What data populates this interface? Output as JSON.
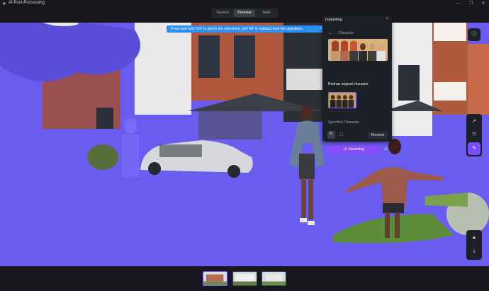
{
  "app": {
    "title": "AI Post-Processing"
  },
  "window_controls": {
    "minimize": "—",
    "maximize": "❐",
    "close": "✕"
  },
  "tabs": [
    {
      "label": "Source",
      "active": false
    },
    {
      "label": "Preview",
      "active": true
    },
    {
      "label": "Task",
      "active": false
    }
  ],
  "toast": {
    "message": "Press and hold 'Ctrl' to add to the selections, and 'Alt' to subtract from the selections.",
    "close": "×"
  },
  "panel": {
    "title": "Inpainting",
    "close": "×",
    "back_label": "Character",
    "redraw_label": "Redraw original character",
    "specified_label": "Specified Character",
    "reverse_label": "Reverse",
    "inpaint_label": "Inpainting",
    "inpaint_icon": "✨"
  },
  "right_toolbar": [
    {
      "icon": "info-icon"
    },
    {
      "icon": "share-icon"
    },
    {
      "icon": "transform-icon"
    },
    {
      "icon": "brush-icon",
      "active": true
    },
    {
      "icon": "lock-icon"
    },
    {
      "icon": "download-icon"
    }
  ],
  "thumbnails": [
    {
      "active": true
    },
    {
      "active": false
    },
    {
      "active": false
    }
  ],
  "colors": {
    "mask": "#6a5cf0",
    "accent": "#7b4cff",
    "toast": "#2f8ff0"
  }
}
